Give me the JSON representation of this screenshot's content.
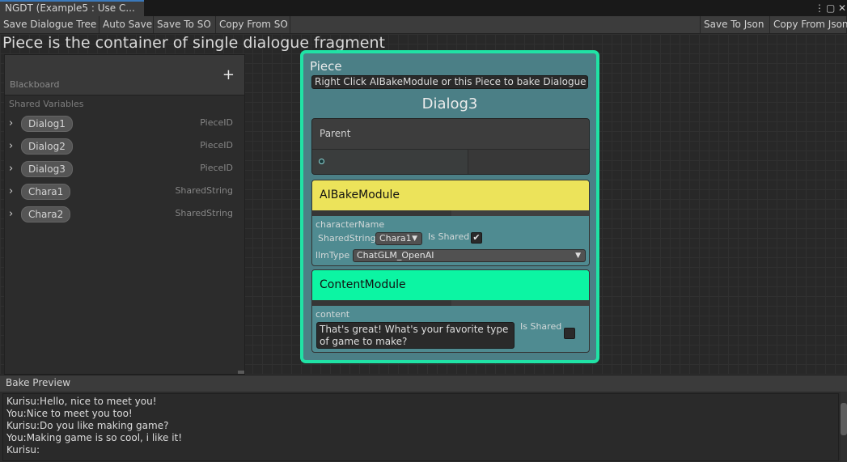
{
  "window": {
    "tab_title": "NGDT (Example5 : Use  C...",
    "kebab": "⋮",
    "maximize": "▢",
    "close": "✕"
  },
  "toolbar": {
    "left": [
      "Save Dialogue Tree",
      "Auto Save",
      "Save To SO",
      "Copy From SO"
    ],
    "right": [
      "Save To Json",
      "Copy From Json"
    ]
  },
  "graph": {
    "title": "Piece is the container of single dialogue fragment"
  },
  "blackboard": {
    "title": "Blackboard",
    "add": "+",
    "section": "Shared Variables",
    "chevron": "›",
    "variables": [
      {
        "name": "Dialog1",
        "type": "PieceID"
      },
      {
        "name": "Dialog2",
        "type": "PieceID"
      },
      {
        "name": "Dialog3",
        "type": "PieceID"
      },
      {
        "name": "Chara1",
        "type": "SharedString"
      },
      {
        "name": "Chara2",
        "type": "SharedString"
      }
    ]
  },
  "piece": {
    "label": "Piece",
    "hint": "Right Click AIBakeModule or this Piece to bake Dialogue",
    "name": "Dialog3",
    "parent_label": "Parent",
    "ai_module": {
      "title": "AIBakeModule",
      "color": "#ece35a",
      "character_label": "characterName",
      "shared_type": "SharedString",
      "shared_value": "Chara1",
      "is_shared_label": "Is Shared",
      "is_shared_checked": "✔",
      "llm_label": "llmType",
      "llm_value": "ChatGLM_OpenAI",
      "dropdown_arrow": "▼"
    },
    "content_module": {
      "title": "ContentModule",
      "color": "#0cf5a3",
      "content_label": "content",
      "content_value": "That's great! What's your favorite type of game to make?",
      "is_shared_label": "Is Shared"
    },
    "border_color": "#20e2a5"
  },
  "preview": {
    "title": "Bake Preview",
    "lines": [
      "Kurisu:Hello, nice to meet you!",
      "You:Nice to meet you too!",
      "Kurisu:Do you like making game?",
      "You:Making game is so cool, i like it!",
      "Kurisu:"
    ]
  }
}
